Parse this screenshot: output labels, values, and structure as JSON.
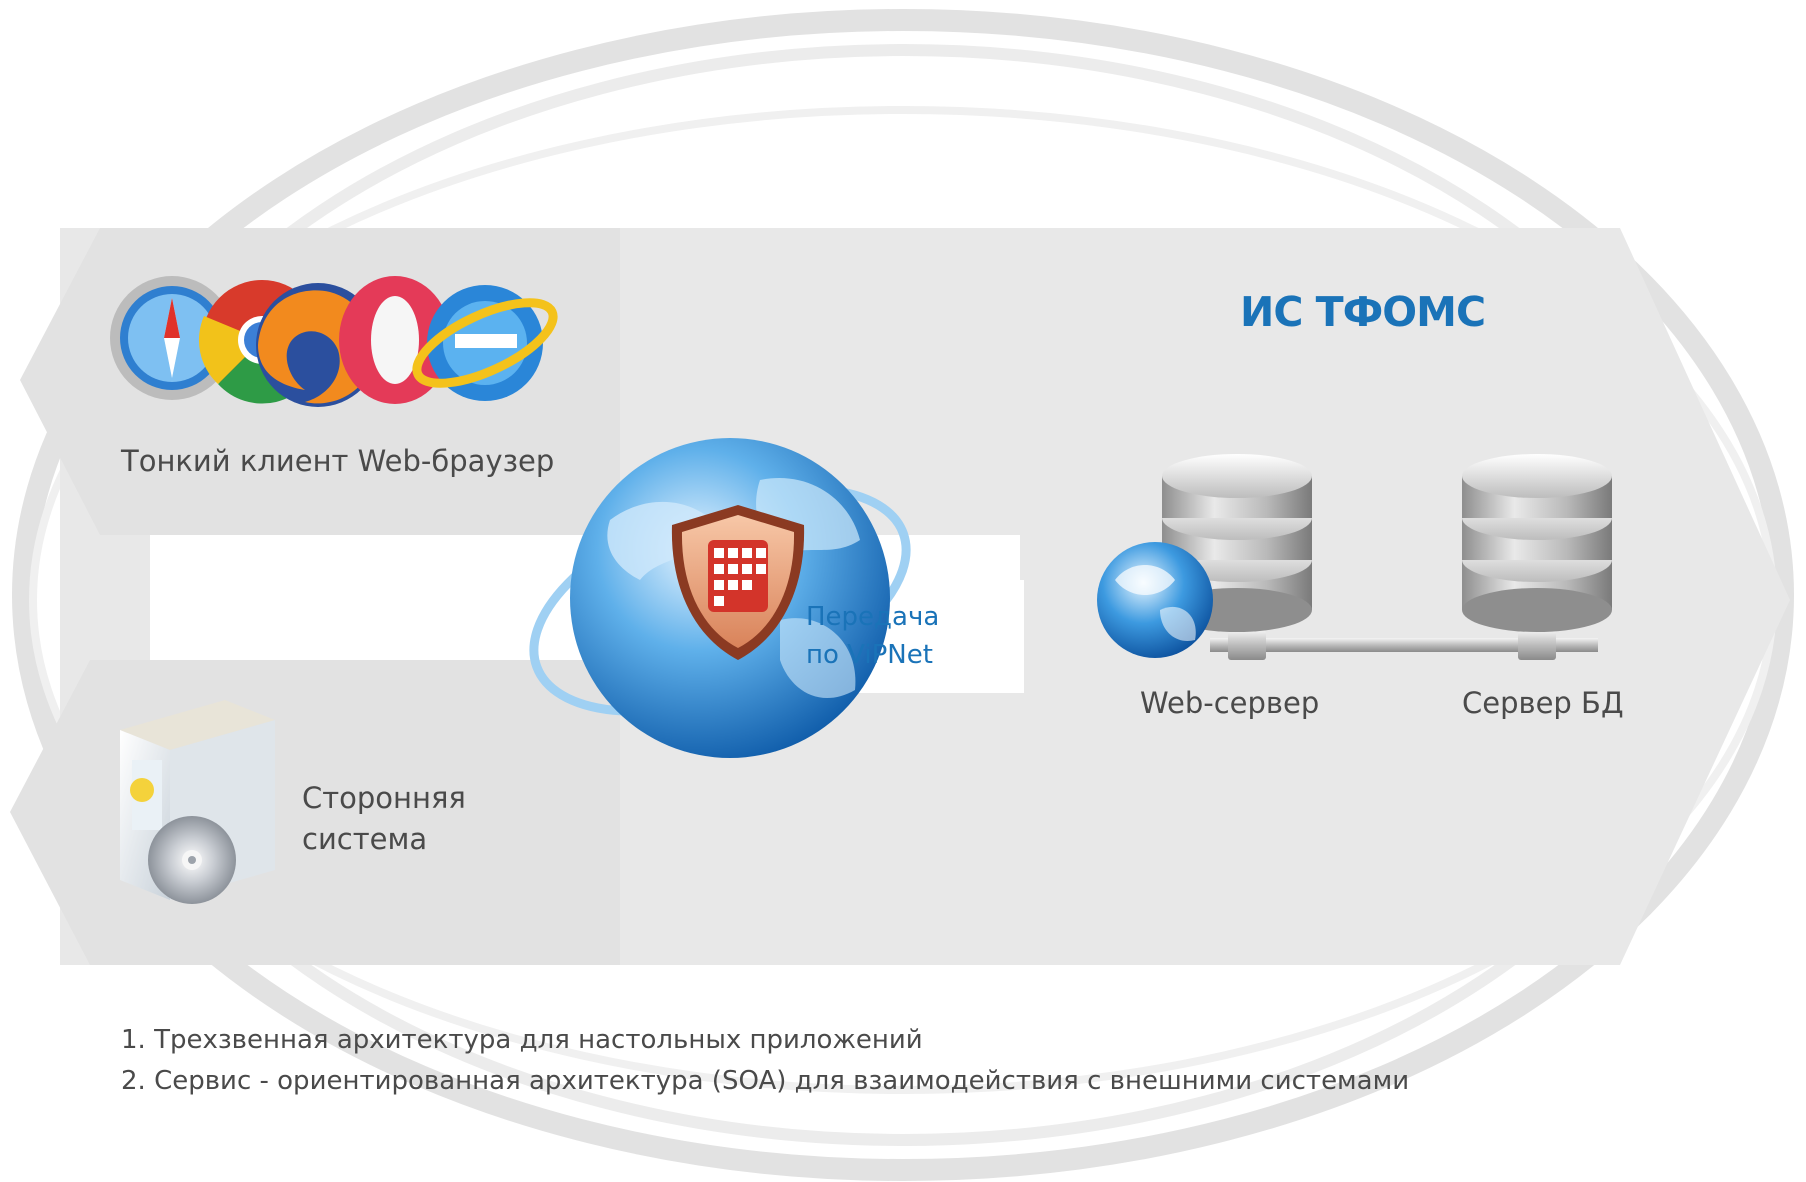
{
  "title": "ИС ТФОМС",
  "thin_client": {
    "label": "Тонкий клиент Web-браузер",
    "icons": [
      "safari-icon",
      "chrome-icon",
      "firefox-icon",
      "opera-icon",
      "internet-explorer-icon"
    ]
  },
  "third_party": {
    "label_line1": "Сторонняя",
    "label_line2": "система"
  },
  "vipnet": {
    "line1": "Передача",
    "line2": "по ViPNet"
  },
  "servers": {
    "web_label": "Web-сервер",
    "db_label": "Сервер БД"
  },
  "notes": [
    "1. Трехзвенная архитектура для настольных приложений",
    "2. Сервис - ориентированная архитектура (SOA) для взаимодействия с внешними системами"
  ],
  "colors": {
    "accent": "#1a73b8",
    "panel": "#e8e8e8",
    "text": "#4a4a4a"
  }
}
